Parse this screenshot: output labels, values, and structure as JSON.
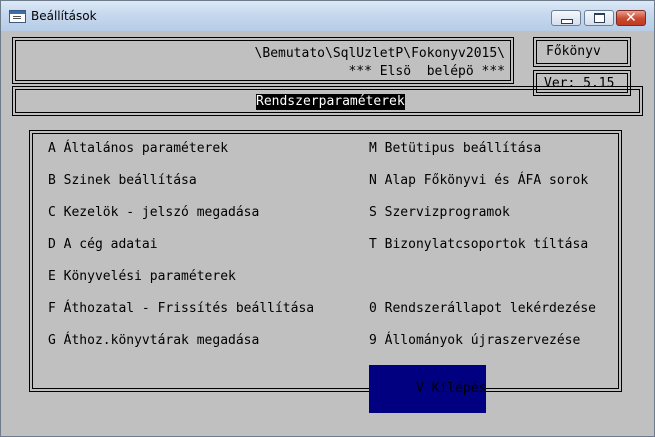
{
  "window": {
    "title": "Beállítások"
  },
  "header": {
    "path": "\\Bemutato\\SqlUzletP\\Fokonyv2015\\",
    "user": "*** Elsö  belépö ***",
    "module": "Főkönyv",
    "version": "Ver: 5.15",
    "section_title": "Rendszerparaméterek"
  },
  "menu": {
    "left": [
      {
        "key": "A",
        "label": "Általános paraméterek"
      },
      {
        "key": "B",
        "label": "Szinek beállítása"
      },
      {
        "key": "C",
        "label": "Kezelök - jelszó megadása"
      },
      {
        "key": "D",
        "label": "A cég adatai"
      },
      {
        "key": "E",
        "label": "Könyvelési paraméterek"
      },
      {
        "key": "F",
        "label": "Áthozatal - Frissítés beállítása"
      },
      {
        "key": "G",
        "label": "Áthoz.könyvtárak megadása"
      }
    ],
    "right": [
      {
        "key": "M",
        "label": "Betütipus beállítása"
      },
      {
        "key": "N",
        "label": "Alap Főkönyvi és ÁFA sorok"
      },
      {
        "key": "S",
        "label": "Szervizprogramok"
      },
      {
        "key": "T",
        "label": "Bizonylatcsoportok tíltása"
      },
      {
        "key": "0",
        "label": "Rendszerállapot lekérdezése"
      },
      {
        "key": "9",
        "label": "Állományok újraszervezése"
      }
    ],
    "exit": {
      "key": "V",
      "label": "Kilépés"
    }
  },
  "colors": {
    "background": "#c0c0c0",
    "selected_bg": "#000080",
    "selected_fg": "#ffff00"
  }
}
